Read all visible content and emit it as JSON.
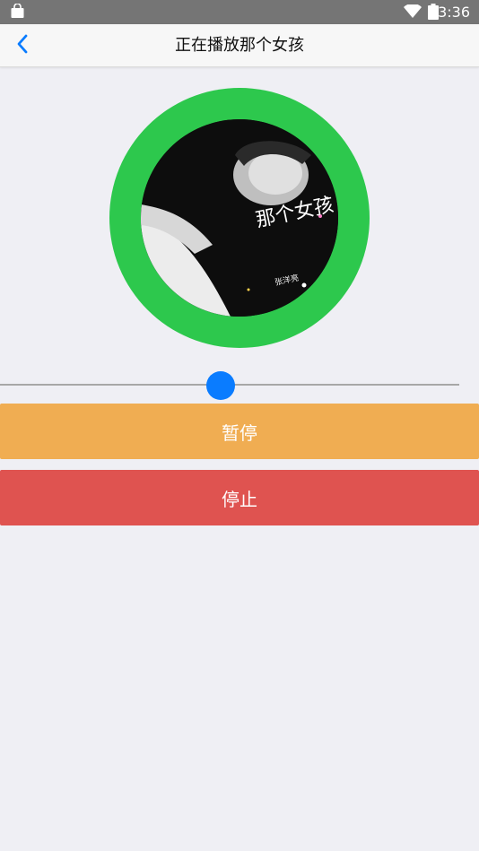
{
  "status_bar": {
    "time": "3:36",
    "icons": [
      "shopping-bag-icon",
      "wifi-icon",
      "battery-icon"
    ]
  },
  "nav": {
    "back_icon": "chevron-left-icon",
    "title": "正在播放那个女孩"
  },
  "player": {
    "cover_text_main": "那个女孩",
    "cover_text_artist": "张洋亮",
    "progress": 0.48
  },
  "controls": {
    "pause_label": "暂停",
    "stop_label": "停止"
  },
  "colors": {
    "status_bar": "#757575",
    "nav_bar": "#f7f7f7",
    "accent_blue": "#0a7cff",
    "disc_ring": "#2dc84d",
    "pause_button": "#f0ad52",
    "stop_button": "#df5350",
    "background": "#efeff4"
  }
}
